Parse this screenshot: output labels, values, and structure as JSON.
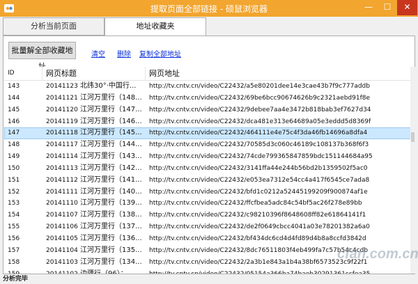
{
  "window": {
    "title": "提取页面全部链接 - 硕鼠浏览器",
    "title_color": "#f2a52f",
    "close_color": "#c7361d",
    "controls": {
      "minimize": "—",
      "maximize": "☐",
      "close": "✕"
    }
  },
  "tabs": [
    {
      "label": "分析当前页面",
      "active": false
    },
    {
      "label": "地址收藏夹",
      "active": true
    }
  ],
  "toolbar": {
    "batch_label": "批量解全部收藏地址",
    "clear_label": "清空",
    "delete_label": "删除",
    "copy_label": "复制全部地址"
  },
  "table": {
    "columns": [
      "ID",
      "网页标题",
      "网页地址"
    ],
    "selected_id": "147",
    "rows": [
      {
        "id": "143",
        "date": "20141123",
        "title": "北纬30°·中国行...",
        "url": "http://tv.cntv.cn/video/C22432/a5e80201dee14e3cae43b7f9c777addb"
      },
      {
        "id": "144",
        "date": "20141121",
        "title": "江河万里行（148...",
        "url": "http://tv.cntv.cn/video/C22432/69be6bcc90674626b9c2321aebd91f8e"
      },
      {
        "id": "145",
        "date": "20141120",
        "title": "江河万里行（147...",
        "url": "http://tv.cntv.cn/video/C22432/9debee7aa4e3472b818bab3ef7627d34"
      },
      {
        "id": "146",
        "date": "20141119",
        "title": "江河万里行（146...",
        "url": "http://tv.cntv.cn/video/C22432/dca481e313e64689a05e3eddd5d8369f"
      },
      {
        "id": "147",
        "date": "20141118",
        "title": "江河万里行（145...",
        "url": "http://tv.cntv.cn/video/C22432/464111e4e75c4f3da46fb14696a8dfa4"
      },
      {
        "id": "148",
        "date": "20141117",
        "title": "江河万里行（144...",
        "url": "http://tv.cntv.cn/video/C22432/70585d3c060c46189c108137b368f6f3"
      },
      {
        "id": "149",
        "date": "20141114",
        "title": "江河万里行（143...",
        "url": "http://tv.cntv.cn/video/C22432/74cde799365847859bdc151144684a95"
      },
      {
        "id": "150",
        "date": "20141113",
        "title": "江河万里行（142...",
        "url": "http://tv.cntv.cn/video/C22432/3141ffa44e244b56bd2b1359502f5ac0"
      },
      {
        "id": "151",
        "date": "20141112",
        "title": "江河万里行（141...",
        "url": "http://tv.cntv.cn/video/C22432/e053ea7312e54cc4a417f6545ce7ada8"
      },
      {
        "id": "152",
        "date": "20141111",
        "title": "江河万里行（140...",
        "url": "http://tv.cntv.cn/video/C22432/bfd1c0212a52445199209f900874af1e"
      },
      {
        "id": "153",
        "date": "20141110",
        "title": "江河万里行（139...",
        "url": "http://tv.cntv.cn/video/C22432/ffcfbea5adc84c54bf5ac26f278e89bb"
      },
      {
        "id": "154",
        "date": "20141107",
        "title": "江河万里行（138...",
        "url": "http://tv.cntv.cn/video/C22432/c98210396f8648608ff82e61864141f1"
      },
      {
        "id": "155",
        "date": "20141106",
        "title": "江河万里行（137...",
        "url": "http://tv.cntv.cn/video/C22432/de2f0649cbcc4041a03e78201382a6a0"
      },
      {
        "id": "156",
        "date": "20141105",
        "title": "江河万里行（136...",
        "url": "http://tv.cntv.cn/video/C22432/bf434dc6cd4d4fd89d4b8a8ccfd3842d"
      },
      {
        "id": "157",
        "date": "20141104",
        "title": "江河万里行（135...",
        "url": "http://tv.cntv.cn/video/C22432/8dc76511803f4eb499fa7c57b54c4cdb"
      },
      {
        "id": "158",
        "date": "20141103",
        "title": "江河万里行（134...",
        "url": "http://tv.cntv.cn/video/C22432/2a3b1e843a1b4a38bf6573523c9f22f1"
      },
      {
        "id": "159",
        "date": "20141102",
        "title": "边疆行（96）：...",
        "url": "http://tv.cntv.cn/video/C22432/05154a366ba74baeb30291361ccfea35"
      },
      {
        "id": "160",
        "date": "20141102",
        "title": "边疆行（95）：...",
        "url": "http://tv.cntv.cn/video/C22432/70f661df2c7b42a58e52d36c049d7ce8"
      }
    ]
  },
  "status": {
    "text": "分析完毕"
  },
  "watermark": "cfan.com.cn"
}
